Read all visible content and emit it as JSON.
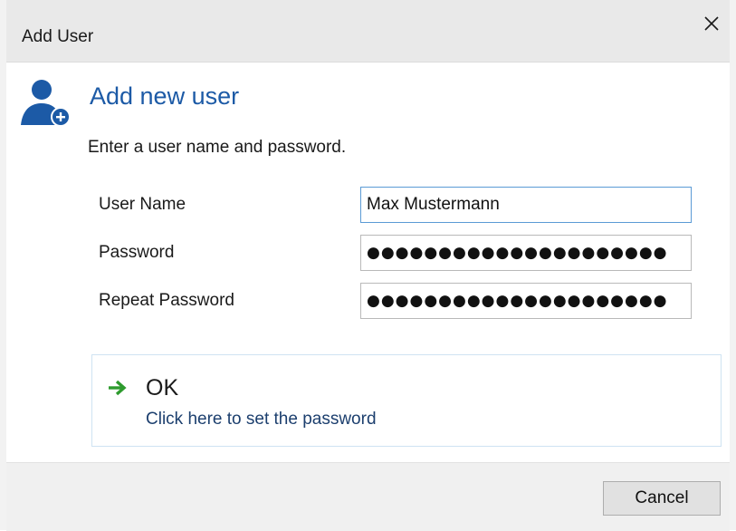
{
  "window": {
    "title": "Add User",
    "close_icon": "close-icon"
  },
  "header": {
    "icon": "add-user-icon",
    "title": "Add new user"
  },
  "instruction": "Enter a user name and password.",
  "form": {
    "username": {
      "label": "User Name",
      "value": "Max Mustermann"
    },
    "password": {
      "label": "Password",
      "value": "●●●●●●●●●●●●●●●●●●●●●"
    },
    "repeat_password": {
      "label": "Repeat Password",
      "value": "●●●●●●●●●●●●●●●●●●●●●"
    }
  },
  "ok_action": {
    "icon": "arrow-right-icon",
    "title": "OK",
    "description": "Click here to set the password",
    "accent": "#2e9b2e"
  },
  "footer": {
    "cancel_label": "Cancel"
  },
  "colors": {
    "heading": "#1c5aa6",
    "icon": "#1c5aa6",
    "focus_border": "#5b9bd5"
  }
}
